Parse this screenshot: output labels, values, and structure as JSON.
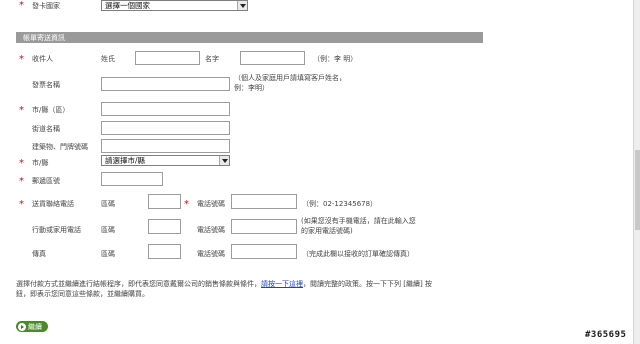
{
  "issuing_country": {
    "label": "發卡國家",
    "selected": "選擇一個國家"
  },
  "section_title": "帳單寄送資訊",
  "recipient": {
    "label": "收件人",
    "surname_label": "姓氏",
    "name_label": "名字",
    "example": "（例：李 明）"
  },
  "invoice_name": {
    "label": "發票名稱",
    "note_line1": "（個人及家庭用戶請填寫客戶姓名，",
    "note_line2": "例：李明）"
  },
  "city_district": {
    "label": "市/縣（區）"
  },
  "street": {
    "label": "街道名稱"
  },
  "building": {
    "label": "建築物、門牌號碼"
  },
  "city": {
    "label": "市/縣",
    "selected": "請選擇市/縣"
  },
  "postal": {
    "label": "郵遞區號"
  },
  "contact_phone": {
    "label": "送貨聯絡電話",
    "area_label": "區碼",
    "phone_label": "電話號碼",
    "example": "（例：02-12345678）"
  },
  "mobile_phone": {
    "label": "行動或家用電話",
    "area_label": "區碼",
    "phone_label": "電話號碼",
    "note_line1": "(如果您沒有手機電話，請在此輸入您",
    "note_line2": "的家用電話號碼)"
  },
  "fax": {
    "label": "傳真",
    "area_label": "區碼",
    "phone_label": "電話號碼",
    "note": "（完成此欄以接收的訂單確認傳真）"
  },
  "terms": {
    "line1_before": "選擇付款方式並繼續進行結帳程序，即代表您同意戴爾公司的銷售條款與條件，",
    "link": "請按一下這裡",
    "line1_after": "，閱讀完整的政策。按一下下列 [繼續] 按",
    "line2": "鈕，即表示您同意這些條款，並繼續購買。"
  },
  "continue_button": "繼續",
  "watermark": "#365695",
  "colors": {
    "required": "#cc1111",
    "section_bar": "#9a9a9a",
    "link": "#1a45b8",
    "button": "#4a8a2a"
  }
}
